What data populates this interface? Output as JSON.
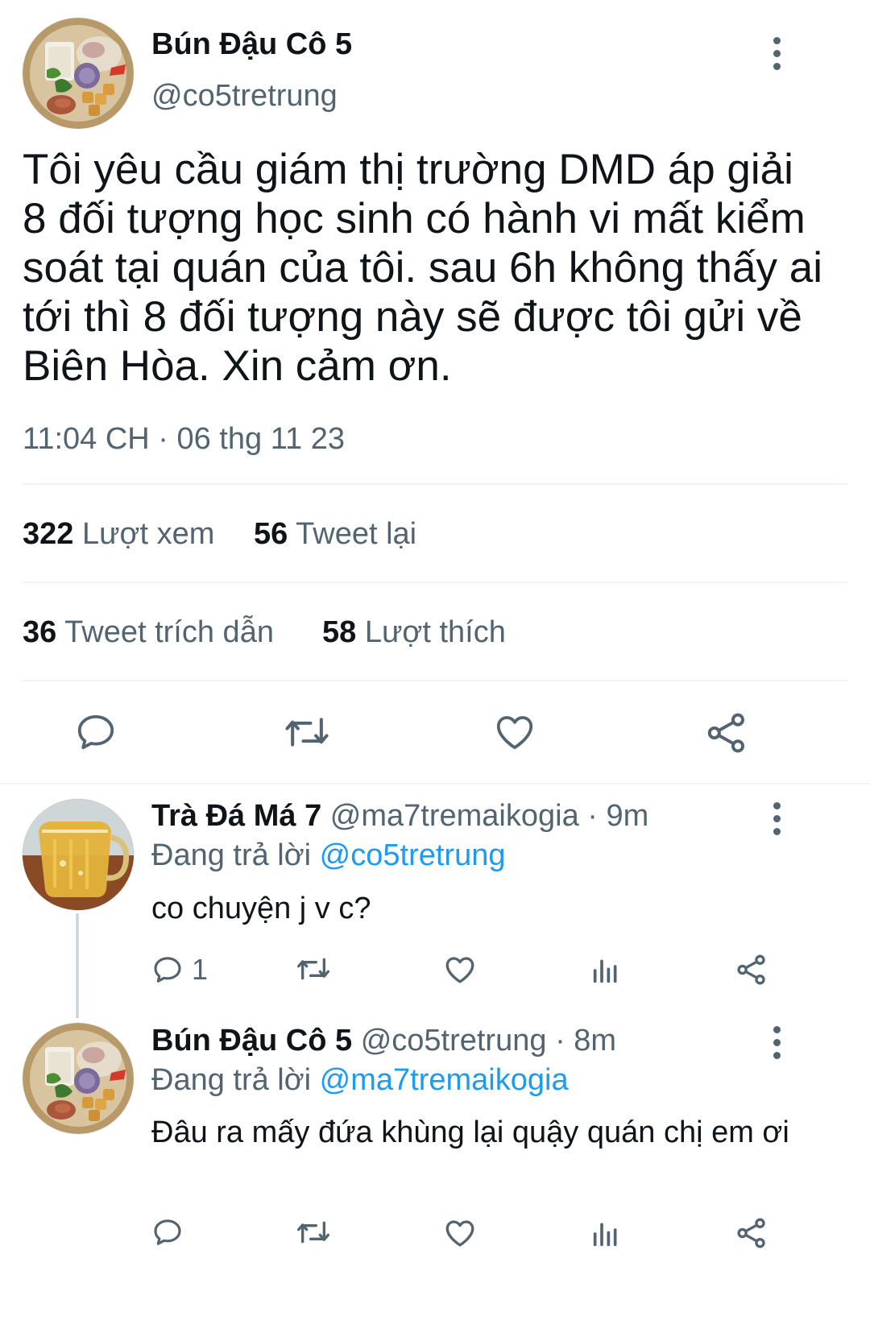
{
  "main_tweet": {
    "author_name": "Bún Đậu Cô 5",
    "author_handle": "@co5tretrung",
    "text": "Tôi yêu cầu giám thị trường DMD áp giải 8 đối tượng học sinh có hành vi mất kiểm soát tại quán của tôi. sau 6h không thấy ai tới thì 8 đối tượng này sẽ được tôi gửi về Biên Hòa. Xin cảm ơn.",
    "timestamp": "11:04 CH · 06 thg 11 23",
    "stats": {
      "views_count": "322",
      "views_label": "Lượt xem",
      "retweets_count": "56",
      "retweets_label": "Tweet lại",
      "quotes_count": "36",
      "quotes_label": "Tweet trích dẫn",
      "likes_count": "58",
      "likes_label": "Lượt thích"
    }
  },
  "replies": [
    {
      "author_name": "Trà Đá Má 7",
      "author_handle": "@ma7tremaikogia",
      "time": "· 9m",
      "replying_label": "Đang trả lời",
      "replying_to": "@co5tretrung",
      "text": "co chuyện j v c?",
      "reply_count": "1"
    },
    {
      "author_name": "Bún Đậu Cô 5",
      "author_handle": "@co5tretrung",
      "time": "· 8m",
      "replying_label": "Đang trả lời",
      "replying_to": "@ma7tremaikogia",
      "text": "Đâu ra mấy đứa khùng lại quậy quán chị em ơi",
      "reply_count": ""
    }
  ],
  "colors": {
    "accent": "#1d9bf0",
    "muted": "#536471",
    "text": "#0f1419",
    "divider": "#eff3f4"
  },
  "icons": [
    "more-vertical-icon",
    "reply-icon",
    "retweet-icon",
    "like-icon",
    "share-icon",
    "analytics-icon"
  ]
}
